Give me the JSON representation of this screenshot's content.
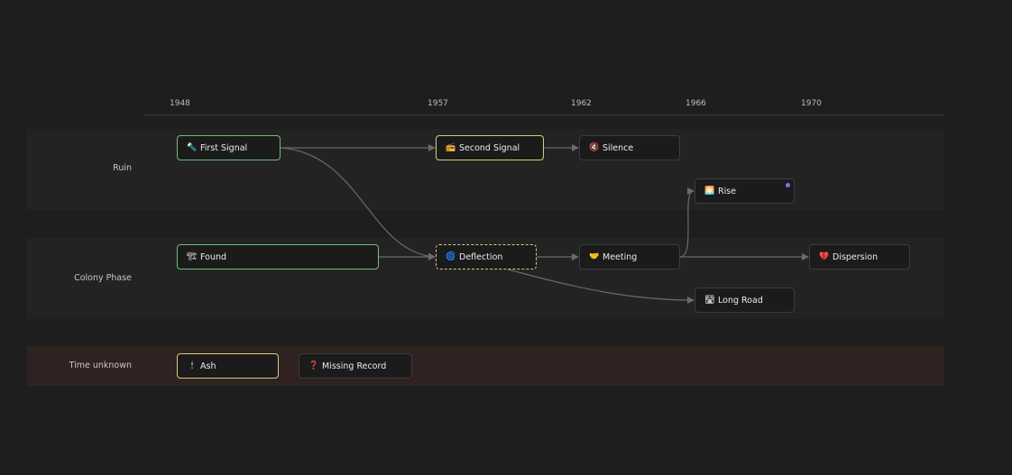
{
  "axis": {
    "ticks": [
      "1948",
      "1957",
      "1962",
      "1966",
      "1970"
    ]
  },
  "lanes": {
    "ruin": "Ruin",
    "colony": "Colony Phase",
    "unknown": "Time unknown"
  },
  "nodes": {
    "first_signal": {
      "label": "First Signal",
      "icon": "🔦"
    },
    "second_signal": {
      "label": "Second Signal",
      "icon": "📻"
    },
    "silence": {
      "label": "Silence",
      "icon": "🔇"
    },
    "rise": {
      "label": "Rise",
      "icon": "🌅"
    },
    "found": {
      "label": "Found",
      "icon": "🏗"
    },
    "deflection": {
      "label": "Deflection",
      "icon": "🌀"
    },
    "meeting": {
      "label": "Meeting",
      "icon": "🤝"
    },
    "dispersion": {
      "label": "Dispersion",
      "icon": "💔"
    },
    "long_road": {
      "label": "Long Road",
      "icon": "🛣"
    },
    "ash": {
      "label": "Ash",
      "icon": "🕯"
    },
    "missing_record": {
      "label": "Missing Record",
      "icon": "❓"
    }
  },
  "colors": {
    "background": "#1e1e1e",
    "lane": "#232323",
    "lane_unknown": "#2f2221",
    "node_green_border": "#6cc07a",
    "node_yellow_border": "#d8cf7a",
    "edge": "#6a6a6a",
    "dot": "#8b6df0"
  }
}
